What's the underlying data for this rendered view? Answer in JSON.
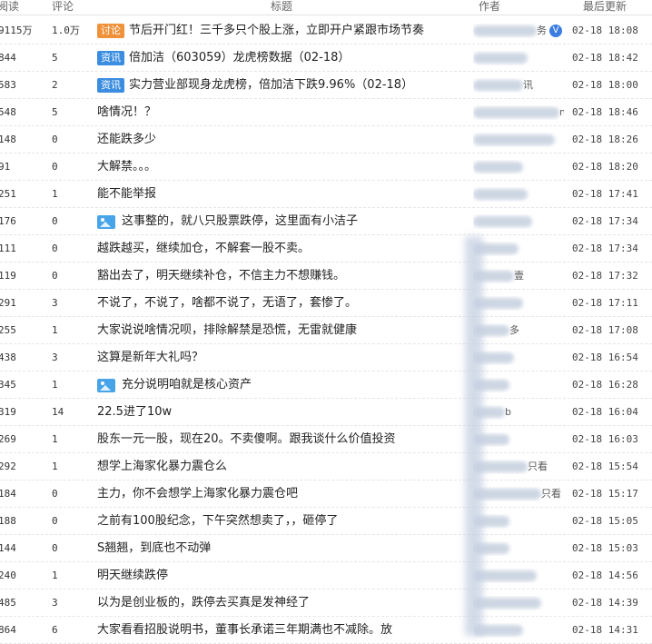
{
  "header": {
    "read": "阅读",
    "comments": "评论",
    "title": "标题",
    "author": "作者",
    "last_update": "最后更新"
  },
  "rows": [
    {
      "read": "9115万",
      "comments": "1.0万",
      "tag": "讨论",
      "tag_type": "discuss",
      "title": "节后开门红！三千多只个股上涨，立即开户紧跟市场节奏",
      "author": "务",
      "verified": true,
      "time": "02-18 18:08"
    },
    {
      "read": "844",
      "comments": "5",
      "tag": "资讯",
      "tag_type": "news",
      "title": "倍加洁（603059）龙虎榜数据（02-18）",
      "author": "",
      "time": "02-18 18:42"
    },
    {
      "read": "583",
      "comments": "2",
      "tag": "资讯",
      "tag_type": "news",
      "title": "实力营业部现身龙虎榜，倍加洁下跌9.96%（02-18）",
      "author": "讯",
      "time": "02-18 18:00"
    },
    {
      "read": "548",
      "comments": "5",
      "title": "啥情况！？",
      "author": "m84",
      "time": "02-18 18:46"
    },
    {
      "read": "148",
      "comments": "0",
      "title": "还能跌多少",
      "author": "",
      "time": "02-18 18:26"
    },
    {
      "read": "91",
      "comments": "0",
      "title": "大解禁。。。",
      "author": "",
      "time": "02-18 18:20"
    },
    {
      "read": "251",
      "comments": "1",
      "title": "能不能举报",
      "author": "",
      "time": "02-18 17:41"
    },
    {
      "read": "176",
      "comments": "0",
      "image": true,
      "title": "这事整的，就八只股票跌停，这里面有小洁子",
      "author": "",
      "time": "02-18 17:34"
    },
    {
      "read": "111",
      "comments": "0",
      "title": "越跌越买，继续加仓，不解套一股不卖。",
      "author": "",
      "time": "02-18 17:34"
    },
    {
      "read": "119",
      "comments": "0",
      "title": "豁出去了，明天继续补仓，不信主力不想赚钱。",
      "author": "壹",
      "time": "02-18 17:32"
    },
    {
      "read": "291",
      "comments": "3",
      "title": "不说了，不说了，啥都不说了，无语了，套惨了。",
      "author": "",
      "time": "02-18 17:11"
    },
    {
      "read": "255",
      "comments": "1",
      "title": "大家说说啥情况呗，排除解禁是恐慌，无雷就健康",
      "author": "多",
      "time": "02-18 17:08"
    },
    {
      "read": "438",
      "comments": "3",
      "title": "这算是新年大礼吗？",
      "author": "",
      "time": "02-18 16:54"
    },
    {
      "read": "345",
      "comments": "1",
      "image": true,
      "title": "充分说明咱就是核心资产",
      "author": "",
      "time": "02-18 16:28"
    },
    {
      "read": "319",
      "comments": "14",
      "title": "22.5进了10w",
      "author": "b",
      "time": "02-18 16:04"
    },
    {
      "read": "269",
      "comments": "1",
      "title": "股东一元一股，现在20。不卖傻啊。跟我谈什么价值投资",
      "author": "",
      "time": "02-18 16:03"
    },
    {
      "read": "292",
      "comments": "1",
      "title": "想学上海家化暴力震仓么",
      "author": "只看",
      "time": "02-18 15:54"
    },
    {
      "read": "184",
      "comments": "0",
      "title": "主力，你不会想学上海家化暴力震仓吧",
      "author": "只看",
      "time": "02-18 15:17"
    },
    {
      "read": "188",
      "comments": "0",
      "title": "之前有100股纪念，下午突然想卖了，，砸停了",
      "author": "",
      "time": "02-18 15:05"
    },
    {
      "read": "144",
      "comments": "0",
      "title": "S翘翘，到底也不动弹",
      "author": "",
      "time": "02-18 15:03"
    },
    {
      "read": "240",
      "comments": "1",
      "title": "明天继续跌停",
      "author": "",
      "time": "02-18 14:56"
    },
    {
      "read": "485",
      "comments": "3",
      "title": "以为是创业板的，跌停去买真是发神经了",
      "author": "",
      "time": "02-18 14:39"
    },
    {
      "read": "864",
      "comments": "6",
      "title": "大家看看招股说明书，董事长承诺三年期满也不减除。放",
      "author": "",
      "time": "02-18 14:31"
    }
  ],
  "colors": {
    "discuss_tag": "#f0923a",
    "news_tag": "#3b8de0",
    "image_icon": "#47a4e8"
  },
  "icons": {
    "image_post": "image-icon",
    "verified": "verified-badge-icon"
  }
}
